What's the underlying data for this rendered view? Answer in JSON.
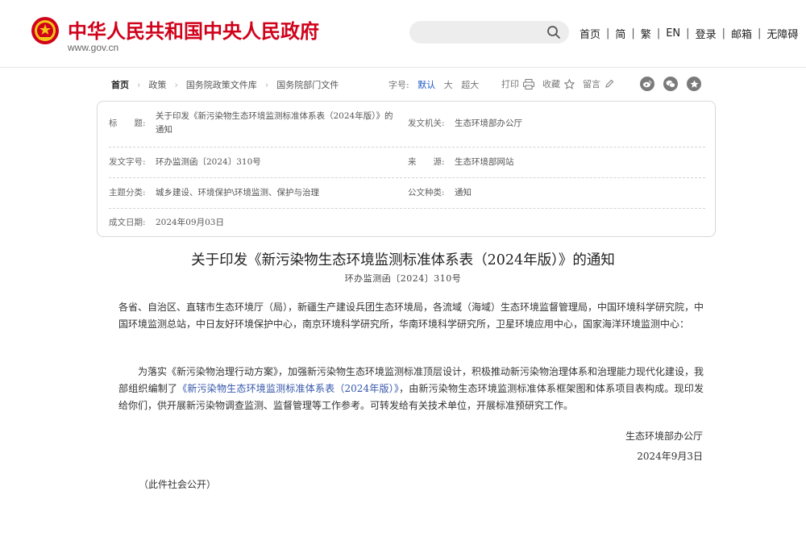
{
  "header": {
    "site_title": "中华人民共和国中央人民政府",
    "domain": "www.gov.cn",
    "search": {
      "placeholder": "",
      "value": ""
    },
    "nav": [
      "首页",
      "简",
      "繁",
      "EN",
      "登录",
      "邮箱",
      "无障碍"
    ]
  },
  "breadcrumb": [
    "首页",
    "政策",
    "国务院政策文件库",
    "国务院部门文件"
  ],
  "font_size": {
    "label": "字号:",
    "options": [
      "默认",
      "大",
      "超大"
    ],
    "active": "默认",
    "active_color": "#1a56c4"
  },
  "tools": [
    {
      "label": "打印",
      "icon": "printer-icon"
    },
    {
      "label": "收藏",
      "icon": "star-icon"
    },
    {
      "label": "留言",
      "icon": "pencil-icon"
    }
  ],
  "share_icons": [
    "weibo-icon",
    "wechat-icon",
    "favorite-share-icon"
  ],
  "info": {
    "title_label": "标　　题:",
    "title_value_line1": "关于印发《新污染物生态环境监测标准体系表（2024年版）》的",
    "title_value_line2": "通知",
    "issuer_label": "发文机关:",
    "issuer_value": "生态环境部办公厅",
    "docno_label": "发文字号:",
    "docno_value": "环办监测函〔2024〕310号",
    "source_label": "来　　源:",
    "source_value": "生态环境部网站",
    "topic_label": "主题分类:",
    "topic_value": "城乡建设、环境保护\\环境监测、保护与治理",
    "doctype_label": "公文种类:",
    "doctype_value": "通知",
    "date_label": "成文日期:",
    "date_value": "2024年09月03日"
  },
  "document": {
    "title": "关于印发《新污染物生态环境监测标准体系表（2024年版）》的通知",
    "number": "环办监测函〔2024〕310号",
    "recipients": "各省、自治区、直辖市生态环境厅（局），新疆生产建设兵团生态环境局，各流域（海域）生态环境监督管理局，中国环境科学研究院，中国环境监测总站，中日友好环境保护中心，南京环境科学研究所，华南环境科学研究所，卫星环境应用中心，国家海洋环境监测中心：",
    "body_part1": "为落实《新污染物治理行动方案》，加强新污染物生态环境监测标准顶层设计，积极推动新污染物治理体系和治理能力现代化建设，我部组织编制了",
    "body_link": "《新污染物生态环境监测标准体系表（2024年版）》",
    "body_part2": "，由新污染物生态环境监测标准体系框架图和体系项目表构成。现印发给你们，供开展新污染物调查监测、监督管理等工作参考。可转发给有关技术单位，开展标准预研究工作。",
    "signer": "生态环境部办公厅",
    "sign_date": "2024年9月3日",
    "public_note": "（此件社会公开）"
  },
  "colors": {
    "brand_red": "#d0021b",
    "link_blue": "#3355aa"
  }
}
